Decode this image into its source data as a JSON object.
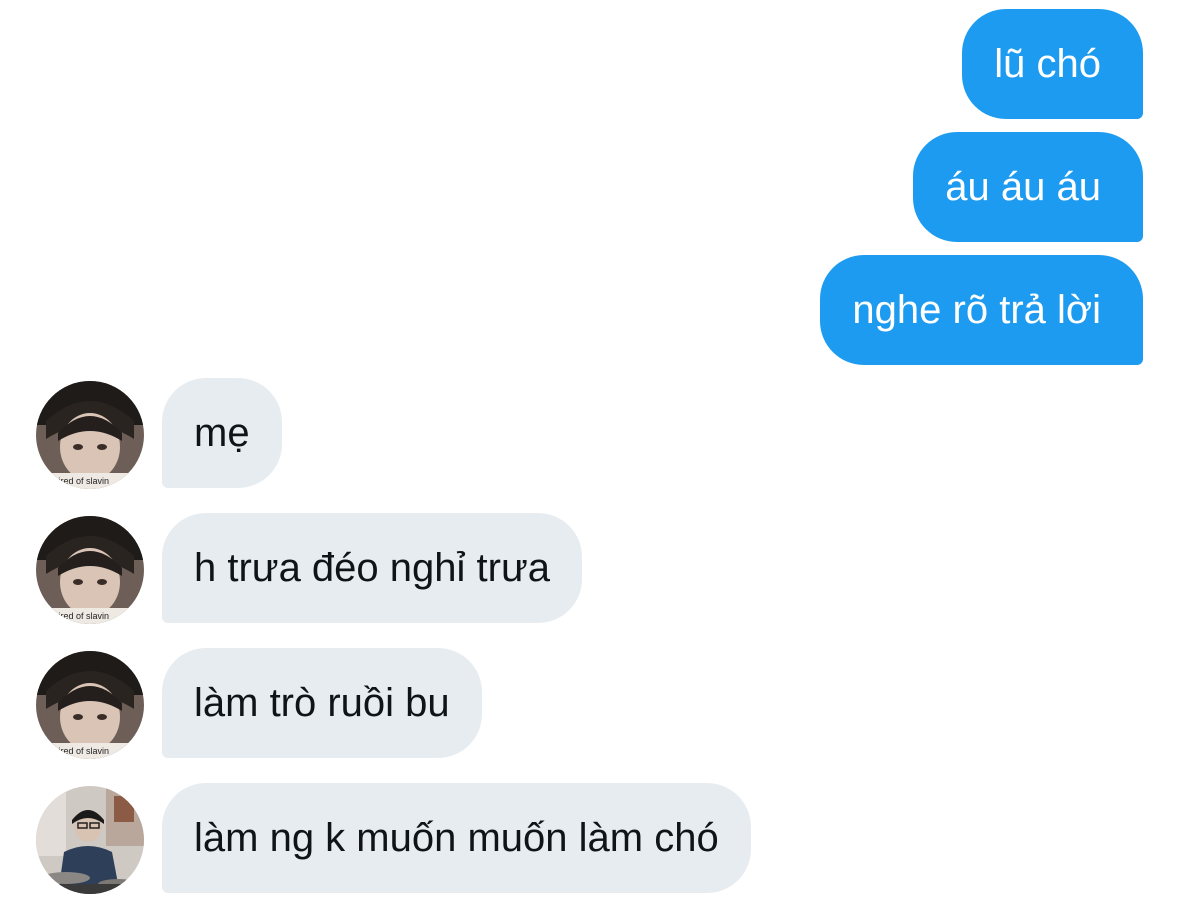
{
  "conversation": {
    "outgoing": [
      {
        "text": "lũ chó"
      },
      {
        "text": "áu áu áu"
      },
      {
        "text": "nghe rõ trả lời"
      }
    ],
    "incoming": [
      {
        "text": "mẹ",
        "avatar": "profile-photo"
      },
      {
        "text": "h trưa đéo nghỉ trưa",
        "avatar": "profile-photo"
      },
      {
        "text": "làm trò ruồi bu",
        "avatar": "profile-photo"
      },
      {
        "text": "làm ng k muốn muốn làm chó",
        "avatar": "profile-photo-alt"
      }
    ],
    "avatar_caption": "tired of slavin"
  },
  "colors": {
    "outgoing_bubble": "#1d9bf0",
    "incoming_bubble": "#e7ecf0",
    "outgoing_text": "#ffffff",
    "incoming_text": "#0f1419"
  }
}
